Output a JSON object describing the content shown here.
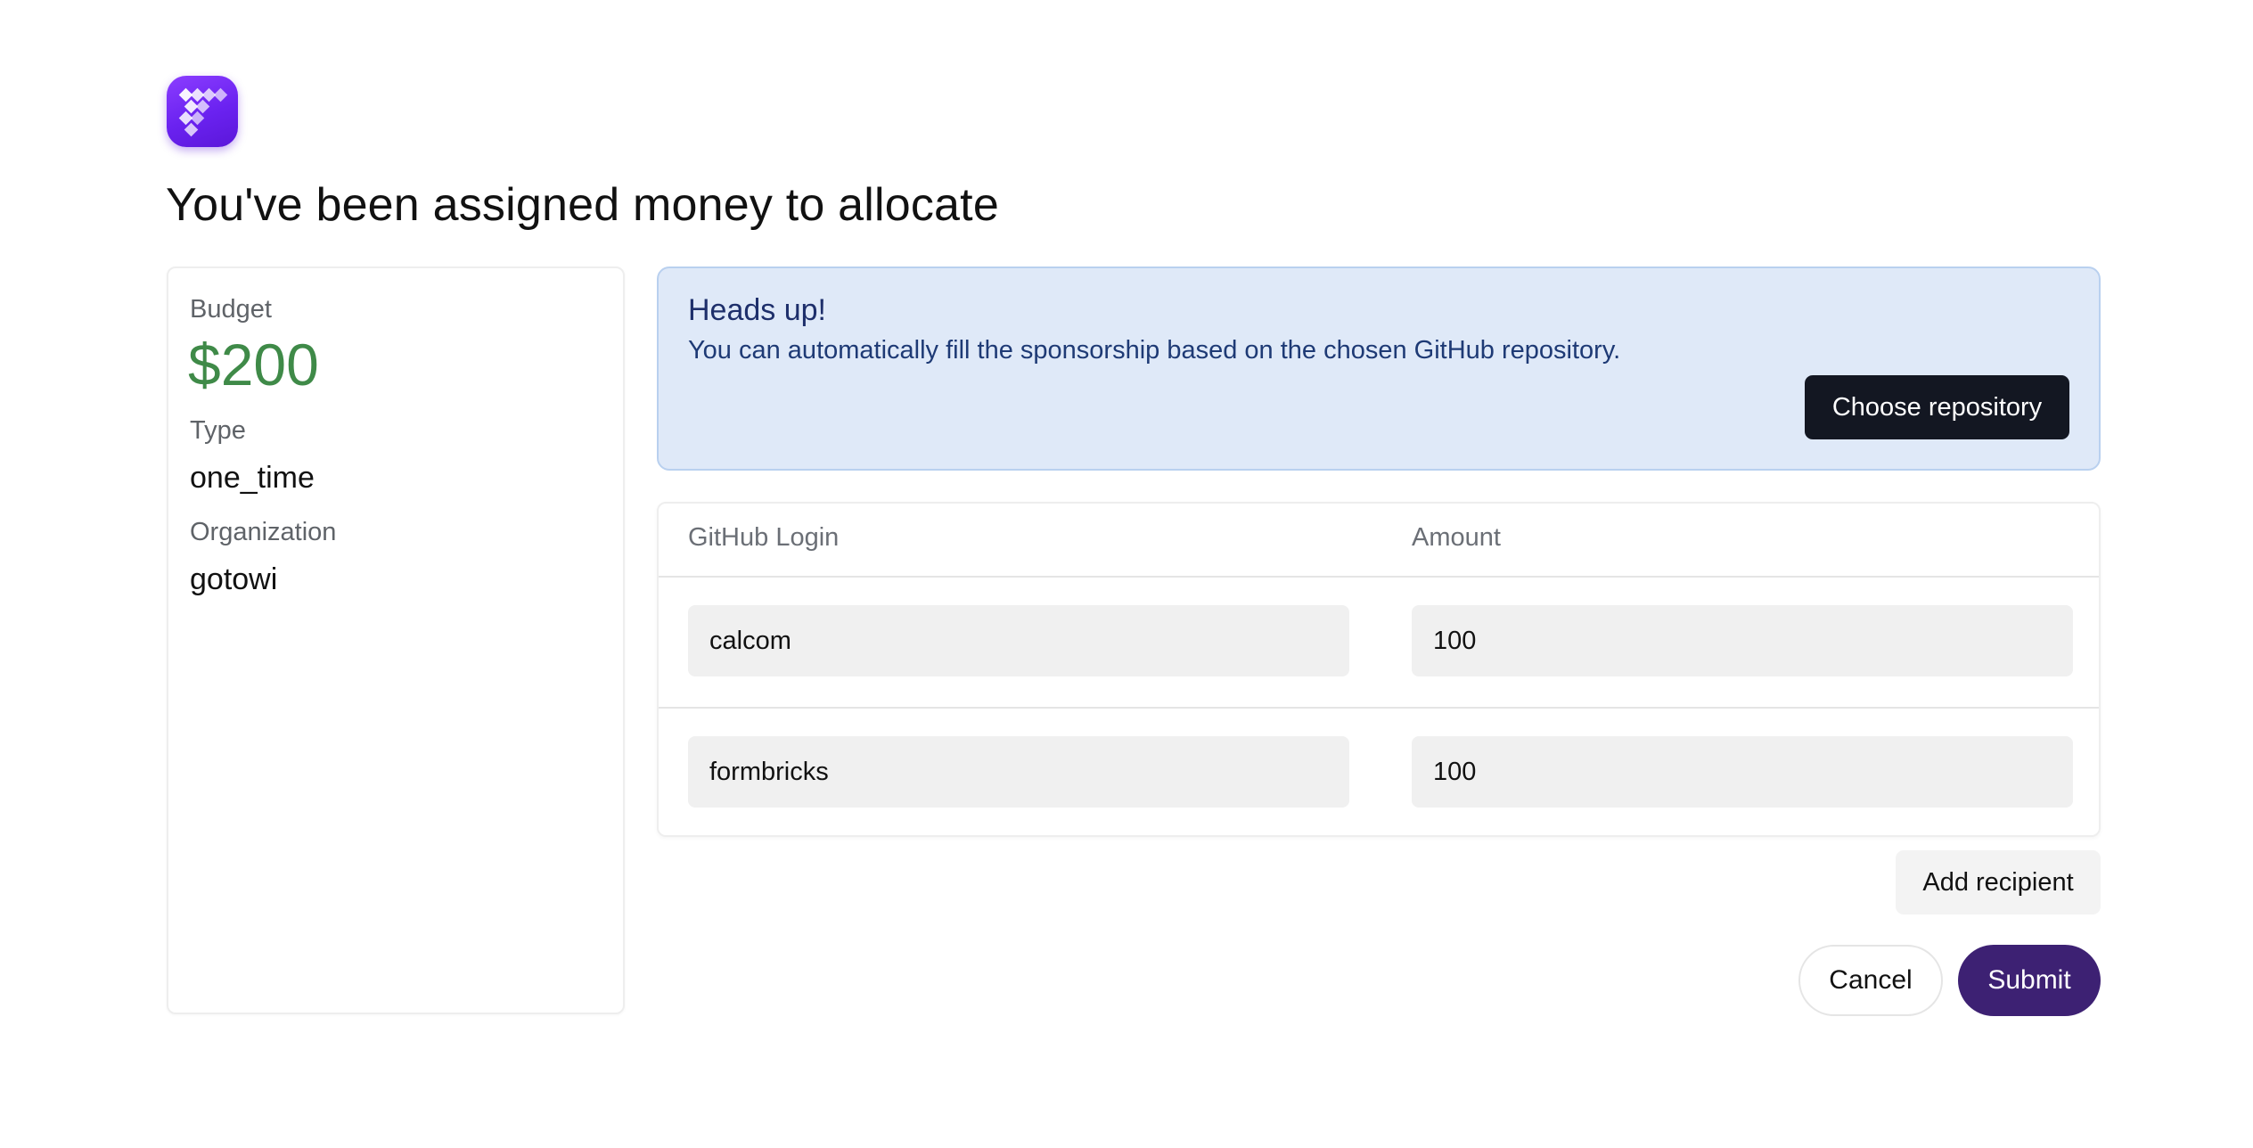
{
  "app": {
    "logo_icon": "formbricks-logo-icon",
    "brand_color": "#6a22f0"
  },
  "page_title": "You've been assigned money to allocate",
  "info": {
    "budget_label": "Budget",
    "budget_value": "$200",
    "type_label": "Type",
    "type_value": "one_time",
    "organization_label": "Organization",
    "organization_value": "gotowi"
  },
  "alert": {
    "title": "Heads up!",
    "description": "You can automatically fill the sponsorship based on the chosen GitHub repository.",
    "button_label": "Choose repository"
  },
  "table": {
    "headers": [
      "GitHub Login",
      "Amount"
    ],
    "rows": [
      {
        "login": "calcom",
        "amount": "100"
      },
      {
        "login": "formbricks",
        "amount": "100"
      }
    ]
  },
  "actions": {
    "add_recipient": "Add recipient",
    "cancel": "Cancel",
    "submit": "Submit"
  },
  "colors": {
    "budget_green": "#3f8a48",
    "alert_bg": "#dfe9f8",
    "primary_dark": "#131722",
    "submit_purple": "#3d2173"
  }
}
